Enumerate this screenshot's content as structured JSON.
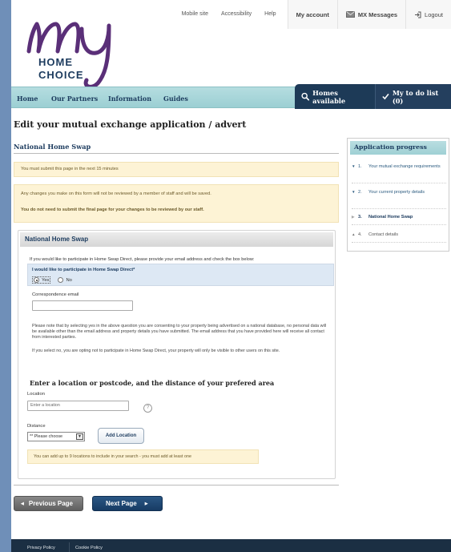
{
  "header": {
    "logo_text": {
      "line1": "HOME",
      "line2": "CHOICE"
    },
    "links": [
      "Mobile site",
      "Accessibility",
      "Help"
    ],
    "account_label": "My account",
    "messages_label": "MX Messages",
    "logout_label": "Logout"
  },
  "nav": {
    "items": [
      "Home",
      "Our Partners",
      "Information",
      "Guides"
    ],
    "homes_available": "Homes available",
    "todo": "My to do list (0)"
  },
  "page_title": "Edit your mutual exchange application / advert",
  "section_title": "National Home Swap",
  "notice_time": "You must submit this page in the next 15 minutes",
  "notice_changes": {
    "line1": "Any changes you make on this form will not be reviewed by a member of staff and will be saved.",
    "line2": "You do not need to submit the final page for your changes to be reviewed by our staff."
  },
  "panel": {
    "title": "National Home Swap",
    "intro": "If you would like to participate in Home Swap Direct, please provide your email address and check the box below:",
    "question": "I would like to participate in Home Swap Direct*",
    "yes_label": "Yes",
    "no_label": "No",
    "email_label": "Correspondence email",
    "email_value": "",
    "consent_text": "Please note that by selecting yes in the above question you are consenting to your property being advertised on a national database, no personal data will be available other than the email address and property details you have submitted. The email address that you have provided here will receive all contact from interested parties.",
    "optout_text": "If you select no, you are opting not to participate in Home Swap Direct, your property will only be visible to other users on this site.",
    "location_heading": "Enter a location or postcode, and the distance of your prefered area",
    "location_label": "Location",
    "location_placeholder": "Enter a location",
    "help_glyph": "?",
    "distance_label": "Distance",
    "distance_selected": "** Please choose",
    "add_location": "Add Location",
    "locations_notice": "You can add up to 9 locations to include in your search - you must add at least one"
  },
  "buttons": {
    "previous": "Previous Page",
    "next": "Next Page"
  },
  "progress": {
    "title": "Application progress",
    "items": [
      {
        "num": "1.",
        "label": "Your mutual exchange requirements"
      },
      {
        "num": "2.",
        "label": "Your current property details"
      },
      {
        "num": "3.",
        "label": "National Home Swap"
      },
      {
        "num": "4.",
        "label": "Contact details"
      }
    ]
  },
  "footer": {
    "links": [
      "Privacy Policy",
      "Cookie Policy"
    ]
  },
  "colors": {
    "navy": "#1c3b5e",
    "purple": "#5a2f78",
    "nav_teal": "#a8d6da",
    "notice_bg": "#fdf3d5",
    "footer_bg": "#1b2f43"
  }
}
